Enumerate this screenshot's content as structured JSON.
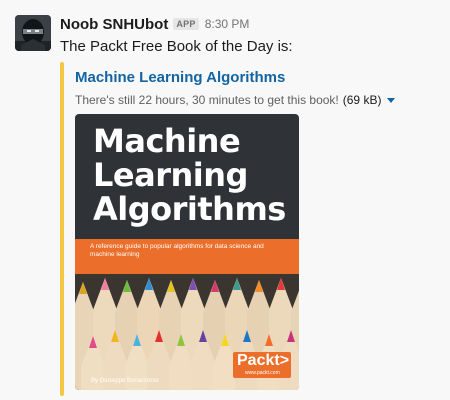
{
  "message": {
    "username": "Noob SNHUbot",
    "badge": "APP",
    "timestamp": "8:30 PM",
    "text": "The Packt Free Book of the Day is:"
  },
  "attachment": {
    "title": "Machine Learning Algorithms",
    "meta": "There's still 22 hours, 30 minutes to get this book!",
    "file_size": "(69 kB)",
    "accent_color": "#f2c744"
  },
  "book_cover": {
    "title_lines": [
      "Machine",
      "Learning",
      "Algorithms"
    ],
    "subtitle": "A reference guide to popular algorithms for data science and machine learning",
    "author": "By Giuseppe Bonaccorso",
    "publisher": "Packt>",
    "publisher_url": "www.packt.com",
    "band_color": "#ec6e2b"
  },
  "icons": {
    "avatar": "ninja-avatar-icon",
    "caret": "caret-down-icon"
  }
}
